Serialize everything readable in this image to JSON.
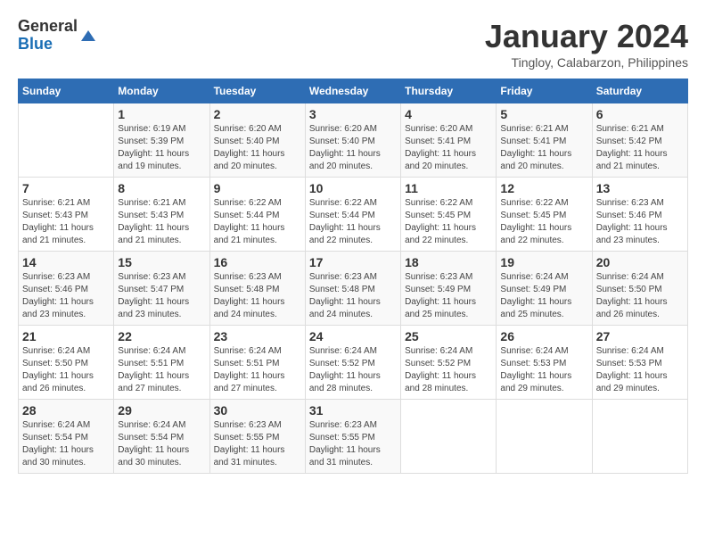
{
  "header": {
    "logo_general": "General",
    "logo_blue": "Blue",
    "month": "January 2024",
    "location": "Tingloy, Calabarzon, Philippines"
  },
  "calendar": {
    "days_of_week": [
      "Sunday",
      "Monday",
      "Tuesday",
      "Wednesday",
      "Thursday",
      "Friday",
      "Saturday"
    ],
    "weeks": [
      [
        {
          "day": "",
          "detail": ""
        },
        {
          "day": "1",
          "detail": "Sunrise: 6:19 AM\nSunset: 5:39 PM\nDaylight: 11 hours\nand 19 minutes."
        },
        {
          "day": "2",
          "detail": "Sunrise: 6:20 AM\nSunset: 5:40 PM\nDaylight: 11 hours\nand 20 minutes."
        },
        {
          "day": "3",
          "detail": "Sunrise: 6:20 AM\nSunset: 5:40 PM\nDaylight: 11 hours\nand 20 minutes."
        },
        {
          "day": "4",
          "detail": "Sunrise: 6:20 AM\nSunset: 5:41 PM\nDaylight: 11 hours\nand 20 minutes."
        },
        {
          "day": "5",
          "detail": "Sunrise: 6:21 AM\nSunset: 5:41 PM\nDaylight: 11 hours\nand 20 minutes."
        },
        {
          "day": "6",
          "detail": "Sunrise: 6:21 AM\nSunset: 5:42 PM\nDaylight: 11 hours\nand 21 minutes."
        }
      ],
      [
        {
          "day": "7",
          "detail": "Sunrise: 6:21 AM\nSunset: 5:43 PM\nDaylight: 11 hours\nand 21 minutes."
        },
        {
          "day": "8",
          "detail": "Sunrise: 6:21 AM\nSunset: 5:43 PM\nDaylight: 11 hours\nand 21 minutes."
        },
        {
          "day": "9",
          "detail": "Sunrise: 6:22 AM\nSunset: 5:44 PM\nDaylight: 11 hours\nand 21 minutes."
        },
        {
          "day": "10",
          "detail": "Sunrise: 6:22 AM\nSunset: 5:44 PM\nDaylight: 11 hours\nand 22 minutes."
        },
        {
          "day": "11",
          "detail": "Sunrise: 6:22 AM\nSunset: 5:45 PM\nDaylight: 11 hours\nand 22 minutes."
        },
        {
          "day": "12",
          "detail": "Sunrise: 6:22 AM\nSunset: 5:45 PM\nDaylight: 11 hours\nand 22 minutes."
        },
        {
          "day": "13",
          "detail": "Sunrise: 6:23 AM\nSunset: 5:46 PM\nDaylight: 11 hours\nand 23 minutes."
        }
      ],
      [
        {
          "day": "14",
          "detail": "Sunrise: 6:23 AM\nSunset: 5:46 PM\nDaylight: 11 hours\nand 23 minutes."
        },
        {
          "day": "15",
          "detail": "Sunrise: 6:23 AM\nSunset: 5:47 PM\nDaylight: 11 hours\nand 23 minutes."
        },
        {
          "day": "16",
          "detail": "Sunrise: 6:23 AM\nSunset: 5:48 PM\nDaylight: 11 hours\nand 24 minutes."
        },
        {
          "day": "17",
          "detail": "Sunrise: 6:23 AM\nSunset: 5:48 PM\nDaylight: 11 hours\nand 24 minutes."
        },
        {
          "day": "18",
          "detail": "Sunrise: 6:23 AM\nSunset: 5:49 PM\nDaylight: 11 hours\nand 25 minutes."
        },
        {
          "day": "19",
          "detail": "Sunrise: 6:24 AM\nSunset: 5:49 PM\nDaylight: 11 hours\nand 25 minutes."
        },
        {
          "day": "20",
          "detail": "Sunrise: 6:24 AM\nSunset: 5:50 PM\nDaylight: 11 hours\nand 26 minutes."
        }
      ],
      [
        {
          "day": "21",
          "detail": "Sunrise: 6:24 AM\nSunset: 5:50 PM\nDaylight: 11 hours\nand 26 minutes."
        },
        {
          "day": "22",
          "detail": "Sunrise: 6:24 AM\nSunset: 5:51 PM\nDaylight: 11 hours\nand 27 minutes."
        },
        {
          "day": "23",
          "detail": "Sunrise: 6:24 AM\nSunset: 5:51 PM\nDaylight: 11 hours\nand 27 minutes."
        },
        {
          "day": "24",
          "detail": "Sunrise: 6:24 AM\nSunset: 5:52 PM\nDaylight: 11 hours\nand 28 minutes."
        },
        {
          "day": "25",
          "detail": "Sunrise: 6:24 AM\nSunset: 5:52 PM\nDaylight: 11 hours\nand 28 minutes."
        },
        {
          "day": "26",
          "detail": "Sunrise: 6:24 AM\nSunset: 5:53 PM\nDaylight: 11 hours\nand 29 minutes."
        },
        {
          "day": "27",
          "detail": "Sunrise: 6:24 AM\nSunset: 5:53 PM\nDaylight: 11 hours\nand 29 minutes."
        }
      ],
      [
        {
          "day": "28",
          "detail": "Sunrise: 6:24 AM\nSunset: 5:54 PM\nDaylight: 11 hours\nand 30 minutes."
        },
        {
          "day": "29",
          "detail": "Sunrise: 6:24 AM\nSunset: 5:54 PM\nDaylight: 11 hours\nand 30 minutes."
        },
        {
          "day": "30",
          "detail": "Sunrise: 6:23 AM\nSunset: 5:55 PM\nDaylight: 11 hours\nand 31 minutes."
        },
        {
          "day": "31",
          "detail": "Sunrise: 6:23 AM\nSunset: 5:55 PM\nDaylight: 11 hours\nand 31 minutes."
        },
        {
          "day": "",
          "detail": ""
        },
        {
          "day": "",
          "detail": ""
        },
        {
          "day": "",
          "detail": ""
        }
      ]
    ]
  }
}
